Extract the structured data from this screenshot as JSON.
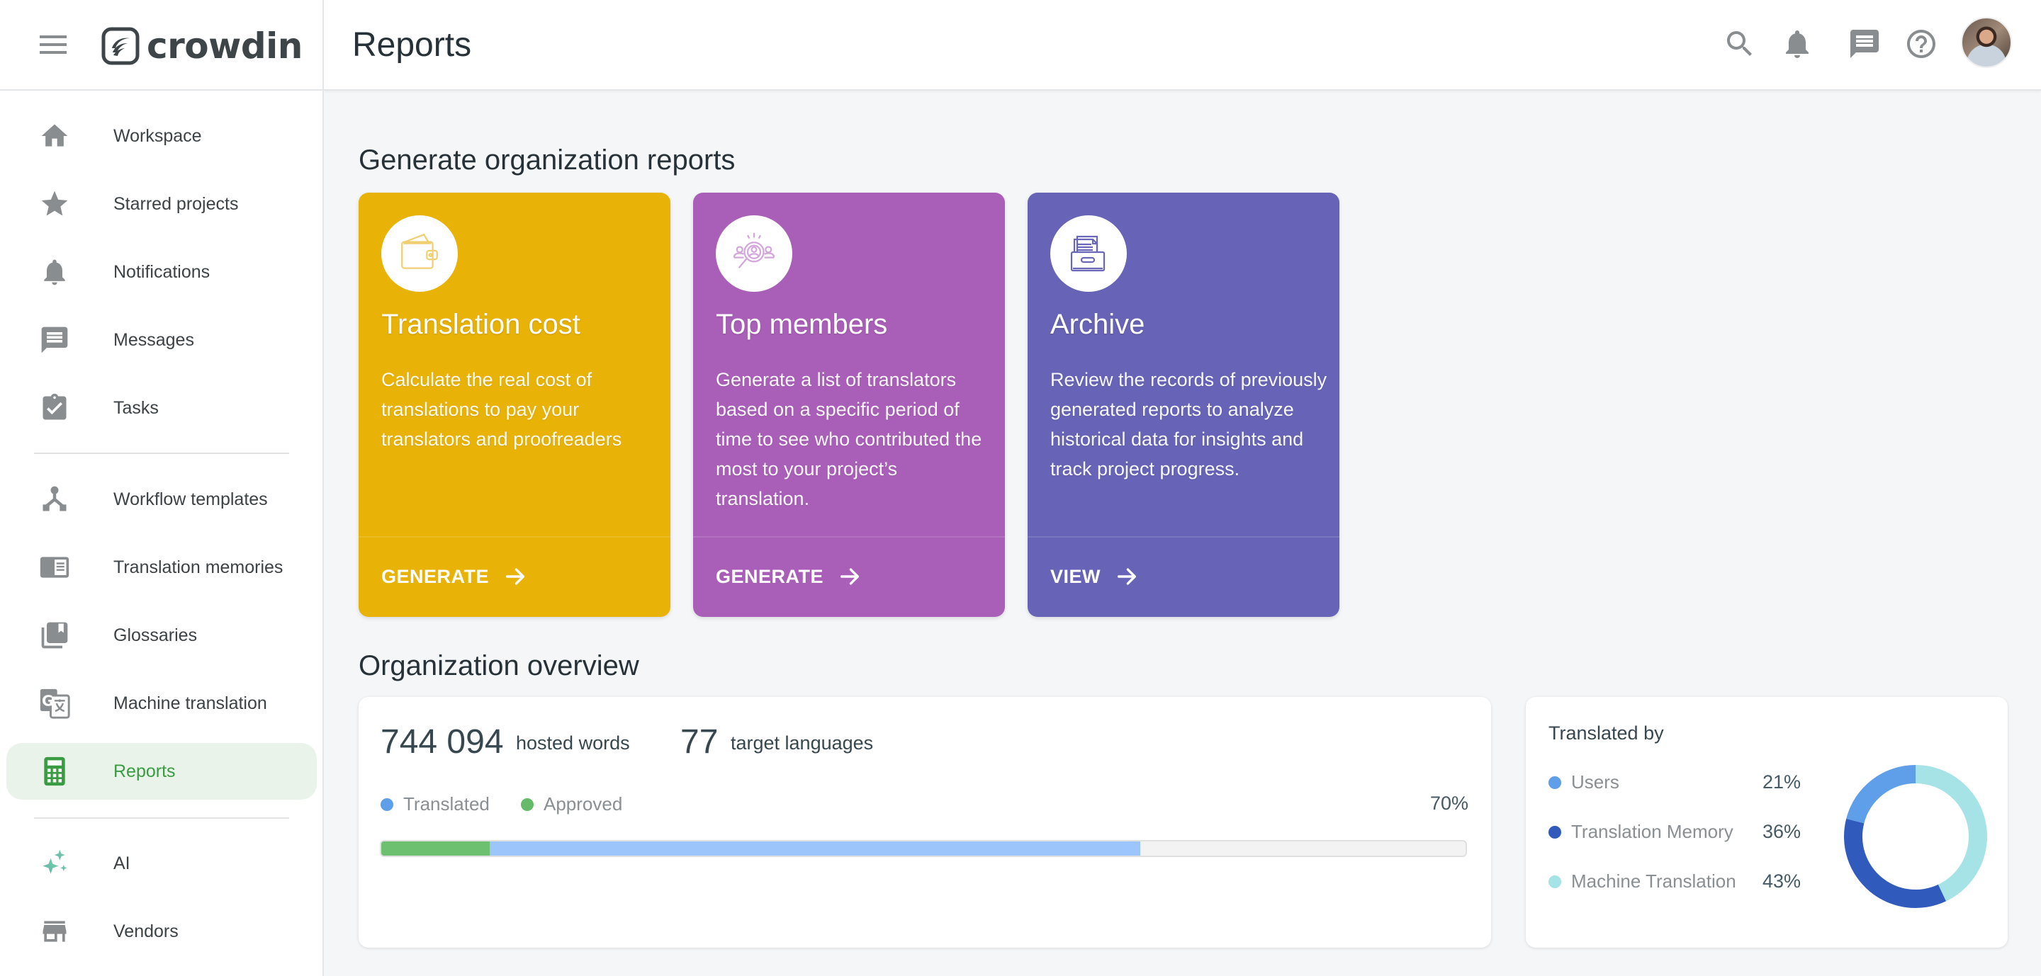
{
  "app": {
    "brand": "crowdin",
    "page_title": "Reports"
  },
  "sidebar": {
    "items": [
      {
        "label": "Workspace",
        "icon": "home-icon"
      },
      {
        "label": "Starred projects",
        "icon": "star-icon"
      },
      {
        "label": "Notifications",
        "icon": "bell-icon"
      },
      {
        "label": "Messages",
        "icon": "message-icon"
      },
      {
        "label": "Tasks",
        "icon": "clipboard-check-icon"
      },
      {
        "label": "Workflow templates",
        "icon": "workflow-icon"
      },
      {
        "label": "Translation memories",
        "icon": "translation-memory-icon"
      },
      {
        "label": "Glossaries",
        "icon": "glossary-icon"
      },
      {
        "label": "Machine translation",
        "icon": "machine-translation-icon"
      },
      {
        "label": "Reports",
        "icon": "calculator-icon",
        "active": true
      },
      {
        "label": "AI",
        "icon": "sparkles-icon"
      },
      {
        "label": "Vendors",
        "icon": "store-icon"
      }
    ]
  },
  "header": {
    "icons": [
      "search-icon",
      "bell-icon",
      "message-icon",
      "help-icon",
      "avatar"
    ]
  },
  "reports_section": {
    "title": "Generate organization reports",
    "cards": [
      {
        "title": "Translation cost",
        "description": "Calculate the real cost of translations to pay your translators and proofreaders",
        "action": "GENERATE",
        "color": "#e8b206",
        "icon": "wallet-icon"
      },
      {
        "title": "Top members",
        "description": "Generate a list of translators based on a specific period of time to see who contributed the most to your project’s translation.",
        "action": "GENERATE",
        "color": "#a95fb8",
        "icon": "member-search-icon"
      },
      {
        "title": "Archive",
        "description": "Review the records of previously generated reports to analyze historical data for insights and track project progress.",
        "action": "VIEW",
        "color": "#6763b6",
        "icon": "archive-icon"
      }
    ]
  },
  "overview": {
    "title": "Organization overview",
    "hosted_words": "744 094",
    "hosted_words_label": "hosted words",
    "target_languages": "77",
    "target_languages_label": "target languages",
    "legend": [
      {
        "label": "Translated",
        "color": "#5f9ee9"
      },
      {
        "label": "Approved",
        "color": "#66bb6a"
      }
    ],
    "progress_label": "70%",
    "progress": {
      "translated_percent": 70,
      "approved_percent": 10,
      "translated_color": "#9cc6fb",
      "approved_color": "#6cc070",
      "track_color": "#f3f3f3"
    }
  },
  "translated_by": {
    "title": "Translated by",
    "items": [
      {
        "label": "Users",
        "value": "21%",
        "percent": 21,
        "color": "#5f9ee9"
      },
      {
        "label": "Translation Memory",
        "value": "36%",
        "percent": 36,
        "color": "#305bbd"
      },
      {
        "label": "Machine Translation",
        "value": "43%",
        "percent": 43,
        "color": "#a6e3e6"
      }
    ]
  },
  "chart_data": {
    "type": "pie",
    "title": "Translated by",
    "categories": [
      "Machine Translation",
      "Translation Memory",
      "Users"
    ],
    "values": [
      43,
      36,
      21
    ],
    "colors": [
      "#a6e3e6",
      "#305bbd",
      "#5f9ee9"
    ],
    "donut": true,
    "direction": "clockwise-from-top",
    "legend": "left"
  }
}
